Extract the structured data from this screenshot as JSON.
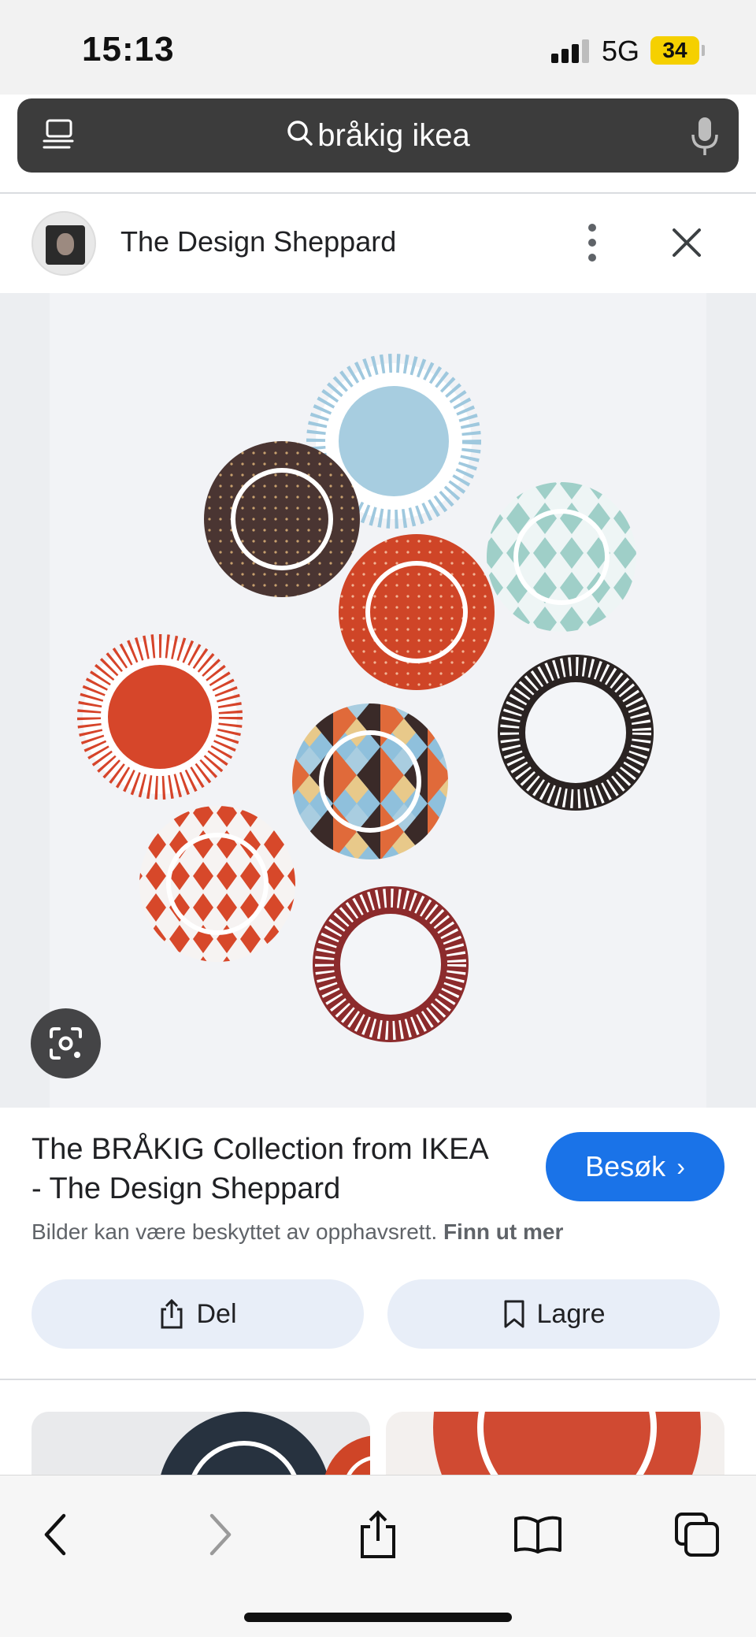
{
  "status_bar": {
    "time": "15:13",
    "network": "5G",
    "battery": "34"
  },
  "search": {
    "query": "bråkig ikea",
    "icons": [
      "tabs-icon",
      "search-icon",
      "microphone-icon"
    ]
  },
  "source": {
    "name": "The Design Sheppard",
    "icons": [
      "more-vertical-icon",
      "close-icon"
    ]
  },
  "image": {
    "subject": "plates",
    "lens_icon": "lens-icon"
  },
  "result": {
    "title": "The BRÅKIG Collection from IKEA - The Design Sheppard",
    "visit_label": "Besøk",
    "copyright_text": "Bilder kan være beskyttet av opphavsrett.",
    "learn_more": "Finn ut mer",
    "share_label": "Del",
    "save_label": "Lagre"
  },
  "toolbar": {
    "icons": [
      "back-icon",
      "forward-icon",
      "share-icon",
      "bookmarks-icon",
      "tabs-icon"
    ]
  },
  "colors": {
    "accent": "#1a73e8",
    "search_bar": "#3c3c3c",
    "action_button_bg": "#e8eef8",
    "battery": "#f5d000"
  }
}
